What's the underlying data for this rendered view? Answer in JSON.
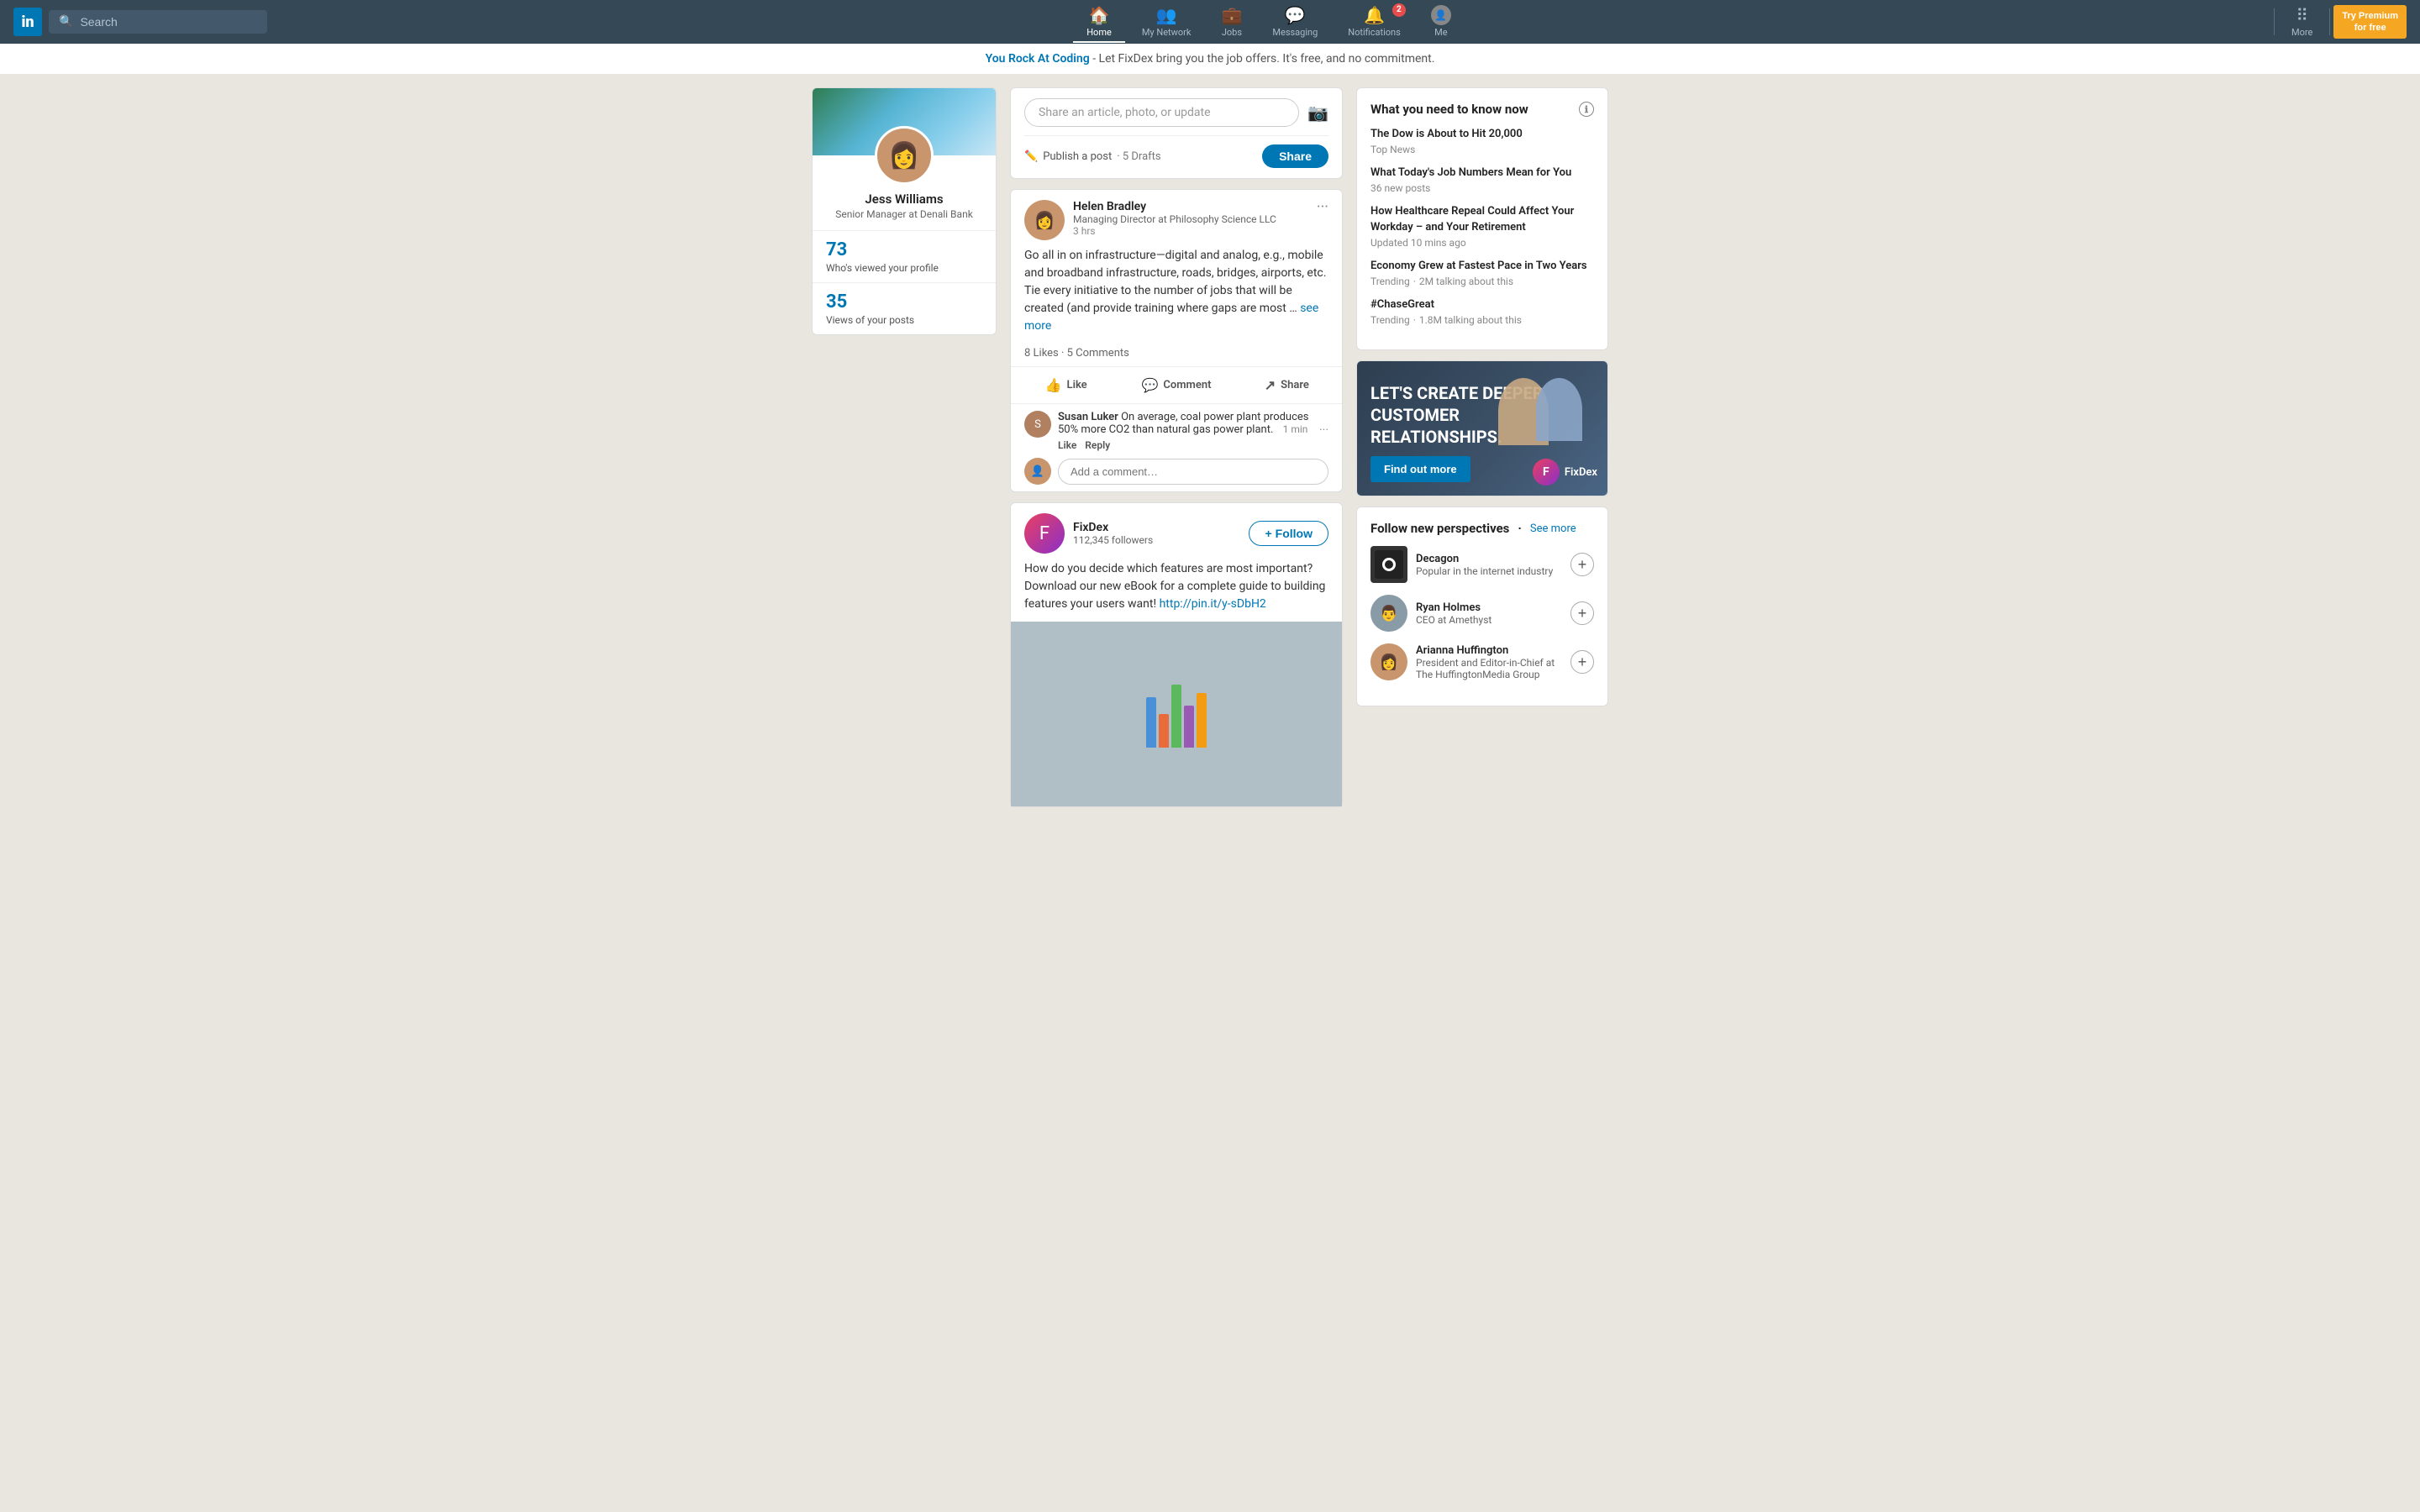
{
  "nav": {
    "logo_text": "in",
    "search_placeholder": "Search",
    "items": [
      {
        "label": "Home",
        "icon": "🏠",
        "active": true,
        "badge": null
      },
      {
        "label": "My Network",
        "icon": "👥",
        "active": false,
        "badge": null
      },
      {
        "label": "Jobs",
        "icon": "💼",
        "active": false,
        "badge": null
      },
      {
        "label": "Messaging",
        "icon": "💬",
        "active": false,
        "badge": null
      },
      {
        "label": "Notifications",
        "icon": "🔔",
        "active": false,
        "badge": "2"
      },
      {
        "label": "Me",
        "icon": "",
        "active": false,
        "badge": null
      }
    ],
    "more_label": "More",
    "premium_label": "Try Premium\nfor free"
  },
  "promo": {
    "highlight": "You Rock At Coding",
    "text": " - Let FixDex bring you the job offers. It's free, and no commitment."
  },
  "profile": {
    "name": "Jess Williams",
    "title": "Senior Manager at Denali Bank",
    "stats": [
      {
        "num": "73",
        "label": "Who's viewed your profile"
      },
      {
        "num": "35",
        "label": "Views of your posts"
      }
    ]
  },
  "share": {
    "placeholder": "Share an article, photo, or update",
    "publish_label": "Publish a post",
    "drafts_label": "5 Drafts",
    "share_btn": "Share"
  },
  "posts": [
    {
      "id": "post1",
      "author": "Helen Bradley",
      "subtitle": "Managing Director at Philosophy Science LLC",
      "time": "3 hrs",
      "body": "Go all in on infrastructure—digital and analog, e.g., mobile and broadband infrastructure, roads, bridges, airports, etc. Tie every initiative to the number of jobs that will be created (and provide training where gaps are most …",
      "see_more": "see more",
      "stats": "8 Likes · 5 Comments",
      "actions": [
        "Like",
        "Comment",
        "Share"
      ],
      "comment": {
        "author": "Susan Luker",
        "text": "On average, coal power plant produces 50% more CO2 than natural gas power plant.",
        "time": "1 min",
        "actions": [
          "Like",
          "Reply"
        ]
      },
      "comment_placeholder": "Add a comment…"
    }
  ],
  "fixdex_post": {
    "name": "FixDex",
    "followers": "112,345 followers",
    "follow_label": "+ Follow",
    "body": "How do you decide which features are most important? Download our new eBook for a complete guide to building features your users want!",
    "link": "http://pin.it/y-sDbH2"
  },
  "news": {
    "title": "What you need to know now",
    "items": [
      {
        "headline": "The Dow is About to Hit 20,000",
        "meta": "Top News",
        "meta2": null
      },
      {
        "headline": "What Today's Job Numbers Mean for You",
        "meta": "36 new posts",
        "meta2": null
      },
      {
        "headline": "How Healthcare Repeal Could Affect Your Workday – and Your Retirement",
        "meta": "Updated 10 mins ago",
        "meta2": null
      },
      {
        "headline": "Economy Grew at Fastest Pace in Two Years",
        "meta": "Trending",
        "meta2": "2M talking about this"
      },
      {
        "headline": "#ChaseGreat",
        "meta": "Trending",
        "meta2": "1.8M talking about this"
      }
    ]
  },
  "ad": {
    "text": "LET'S CREATE DEEPER CUSTOMER RELATIONSHIPS.",
    "cta": "Find out more",
    "brand": "FixDex"
  },
  "follow_perspectives": {
    "title": "Follow new perspectives",
    "see_more": "See more",
    "people": [
      {
        "name": "Decagon",
        "title": "Popular in the internet industry",
        "type": "company"
      },
      {
        "name": "Ryan Holmes",
        "title": "CEO at Amethyst",
        "type": "person"
      },
      {
        "name": "Arianna Huffington",
        "title": "President and Editor-in-Chief at The HuffingtonMedia Group",
        "type": "person"
      }
    ]
  }
}
